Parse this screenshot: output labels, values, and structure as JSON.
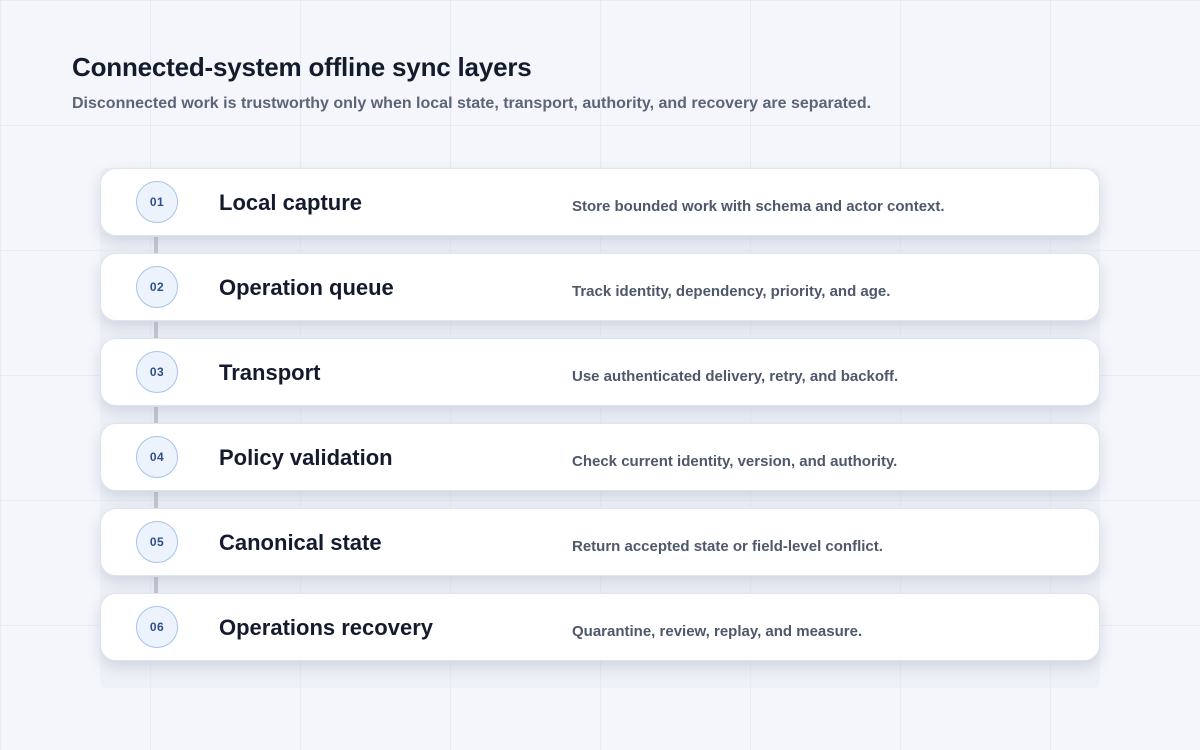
{
  "header": {
    "title": "Connected-system offline sync layers",
    "subtitle": "Disconnected work is trustworthy only when local state, transport, authority, and recovery are separated."
  },
  "layers": [
    {
      "number": "01",
      "name": "Local capture",
      "description": "Store bounded work with schema and actor context."
    },
    {
      "number": "02",
      "name": "Operation queue",
      "description": "Track identity, dependency, priority, and age."
    },
    {
      "number": "03",
      "name": "Transport",
      "description": "Use authenticated delivery, retry, and backoff."
    },
    {
      "number": "04",
      "name": "Policy validation",
      "description": "Check current identity, version, and authority."
    },
    {
      "number": "05",
      "name": "Canonical state",
      "description": "Return accepted state or field-level conflict."
    },
    {
      "number": "06",
      "name": "Operations recovery",
      "description": "Quarantine, review, replay, and measure."
    }
  ],
  "colors": {
    "title": "#141b2d",
    "subtitle": "#5b6578",
    "badge_fill": "#edf3fd",
    "badge_border": "#a9c3ea",
    "badge_text": "#2e4f8a",
    "connector": "#c3c7cf",
    "card_background": "#ffffff"
  }
}
